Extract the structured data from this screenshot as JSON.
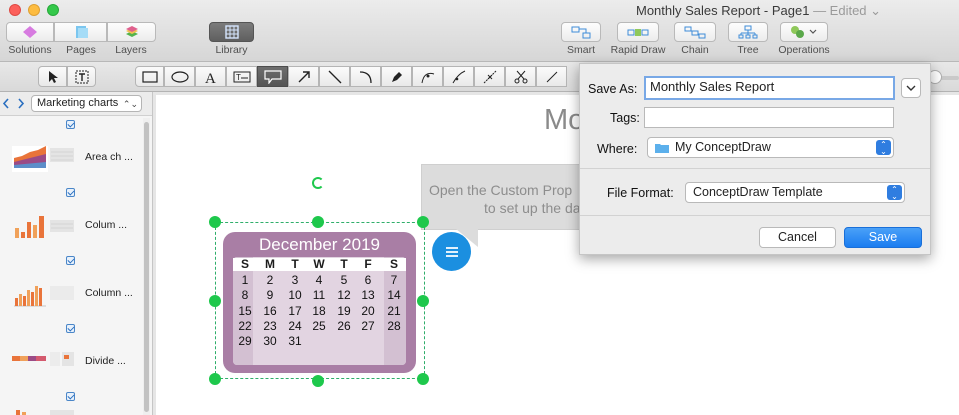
{
  "window": {
    "title": "Monthly Sales Report - Page1",
    "edited": "— Edited ⌄"
  },
  "toolbar": {
    "left": [
      {
        "label": "Solutions"
      },
      {
        "label": "Pages"
      },
      {
        "label": "Layers"
      }
    ],
    "library": "Library",
    "right": [
      {
        "label": "Smart"
      },
      {
        "label": "Rapid Draw"
      },
      {
        "label": "Chain"
      },
      {
        "label": "Tree"
      },
      {
        "label": "Operations"
      }
    ]
  },
  "sidebar": {
    "dropdown": "Marketing charts",
    "items": [
      {
        "label": "Area ch ..."
      },
      {
        "label": "Colum ..."
      },
      {
        "label": "Column ..."
      },
      {
        "label": "Divide ..."
      }
    ]
  },
  "canvas": {
    "heading": "Mo",
    "callout_line1": "Open the Custom Prop",
    "callout_line2": "to set up the da"
  },
  "calendar": {
    "title": "December 2019",
    "weekdays": [
      "S",
      "M",
      "T",
      "W",
      "T",
      "F",
      "S"
    ],
    "rows": [
      [
        "1",
        "2",
        "3",
        "4",
        "5",
        "6",
        "7"
      ],
      [
        "8",
        "9",
        "10",
        "11",
        "12",
        "13",
        "14"
      ],
      [
        "15",
        "16",
        "17",
        "18",
        "19",
        "20",
        "21"
      ],
      [
        "22",
        "23",
        "24",
        "25",
        "26",
        "27",
        "28"
      ],
      [
        "29",
        "30",
        "31",
        "",
        "",
        "",
        ""
      ]
    ]
  },
  "dialog": {
    "save_as_label": "Save As:",
    "save_as_value": "Monthly Sales Report",
    "tags_label": "Tags:",
    "tags_value": "",
    "where_label": "Where:",
    "where_value": "My ConceptDraw",
    "format_label": "File Format:",
    "format_value": "ConceptDraw Template",
    "cancel": "Cancel",
    "save": "Save"
  },
  "colors": {
    "accent": "#2f7de0",
    "calendar": "#a97ea5",
    "selection": "#1ec84c"
  }
}
